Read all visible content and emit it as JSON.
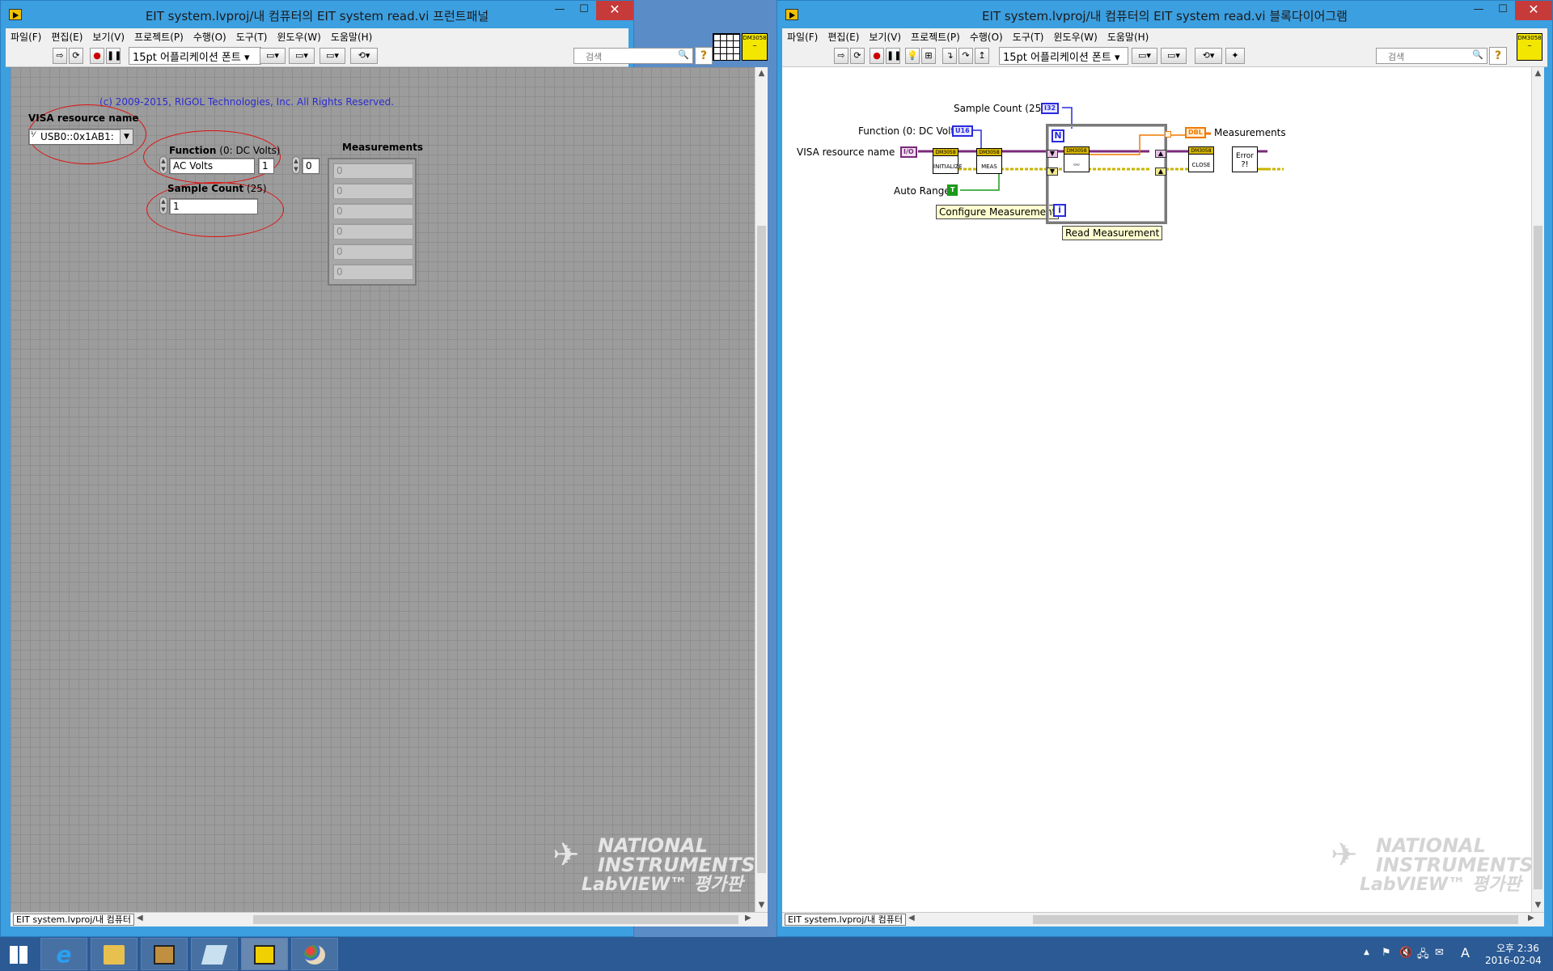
{
  "left_window": {
    "title": "EIT system.lvproj/내 컴퓨터의 EIT system read.vi 프런트패널",
    "menu": [
      "파일(F)",
      "편집(E)",
      "보기(V)",
      "프로젝트(P)",
      "수행(O)",
      "도구(T)",
      "윈도우(W)",
      "도움말(H)"
    ],
    "font_selector": "15pt 어플리케이션 폰트",
    "search_placeholder": "검색",
    "status_context": "EIT system.lvproj/내 컴퓨터",
    "copyright": "(c) 2009-2015, RIGOL Technologies, Inc.  All Rights Reserved.",
    "visa": {
      "label": "VISA resource name",
      "value": "USB0::0x1AB1:"
    },
    "function": {
      "label": "Function",
      "hint": "(0: DC Volts)",
      "value": "AC Volts",
      "number": "1"
    },
    "sample_count": {
      "label": "Sample Count",
      "hint": "(25)",
      "value": "1"
    },
    "index_value": "0",
    "measurements": {
      "label": "Measurements",
      "values": [
        "0",
        "0",
        "0",
        "0",
        "0",
        "0"
      ]
    }
  },
  "right_window": {
    "title": "EIT system.lvproj/내 컴퓨터의 EIT system read.vi 블록다이어그램",
    "menu": [
      "파일(F)",
      "편집(E)",
      "보기(V)",
      "프로젝트(P)",
      "수행(O)",
      "도구(T)",
      "윈도우(W)",
      "도움말(H)"
    ],
    "font_selector": "15pt 어플리케이션 폰트",
    "search_placeholder": "검색",
    "status_context": "EIT system.lvproj/내 컴퓨터",
    "diagram": {
      "sample_count_label": "Sample Count (25)",
      "sample_count_type": "I32",
      "function_label": "Function (0: DC Volts)",
      "function_type": "U16",
      "visa_label": "VISA resource name",
      "visa_type": "I/O",
      "auto_range_label": "Auto Range",
      "auto_range_const": "T",
      "measurements_label": "Measurements",
      "measurements_type": "DBL",
      "loop_count": "N",
      "loop_index": "i",
      "initialize_text": "INITIALIZE",
      "meas_text": "MEAS",
      "close_text": "CLOSE",
      "error_text": "Error",
      "vi_prefix": "DM3058",
      "configure_note": "Configure Measurement",
      "read_note": "Read Measurement"
    }
  },
  "watermark": {
    "line1": "NATIONAL",
    "line2": "INSTRUMENTS",
    "line3": "LabVIEW™ 평가판"
  },
  "taskbar": {
    "time": "오후 2:36",
    "date": "2016-02-04",
    "ime": "A"
  },
  "colors": {
    "title_bar": "#3c9fe0",
    "close_button": "#c73a3a",
    "annotation": "#e01010",
    "copyright": "#2b2bd0",
    "taskbar": "#2b5a94"
  }
}
